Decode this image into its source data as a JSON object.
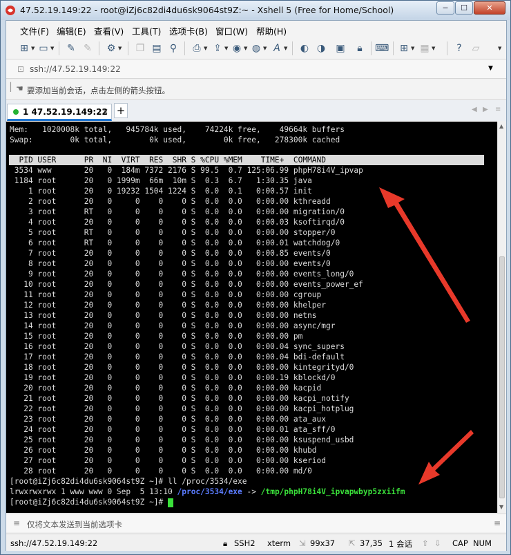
{
  "window": {
    "title": "47.52.19.149:22 - root@iZj6c82di4du6sk9064st9Z:~ - Xshell 5 (Free for Home/School)",
    "min": "−",
    "max": "☐",
    "close": "✕"
  },
  "menu": [
    "文件(F)",
    "编辑(E)",
    "查看(V)",
    "工具(T)",
    "选项卡(B)",
    "窗口(W)",
    "帮助(H)"
  ],
  "address": {
    "value": "ssh://47.52.19.149:22"
  },
  "info": {
    "text": "要添加当前会话，点击左侧的箭头按钮。"
  },
  "tab": {
    "label": "1 47.52.19.149:22",
    "close": "×",
    "add": "+"
  },
  "terminal": {
    "lines": [
      "Mem:   1020008k total,   945784k used,    74224k free,    49664k buffers",
      "Swap:        0k total,        0k used,        0k free,   278300k cached",
      "",
      "  PID USER      PR  NI  VIRT  RES  SHR S %CPU %MEM    TIME+  COMMAND",
      " 3534 www       20   0  184m 7372 2176 S 99.5  0.7 125:06.99 phpH78i4V_ipvap",
      " 1184 root      20   0 1999m  66m  10m S  0.3  6.7   1:30.35 java",
      "    1 root      20   0 19232 1504 1224 S  0.0  0.1   0:00.57 init",
      "    2 root      20   0     0    0    0 S  0.0  0.0   0:00.00 kthreadd",
      "    3 root      RT   0     0    0    0 S  0.0  0.0   0:00.00 migration/0",
      "    4 root      20   0     0    0    0 S  0.0  0.0   0:00.03 ksoftirqd/0",
      "    5 root      RT   0     0    0    0 S  0.0  0.0   0:00.00 stopper/0",
      "    6 root      RT   0     0    0    0 S  0.0  0.0   0:00.01 watchdog/0",
      "    7 root      20   0     0    0    0 S  0.0  0.0   0:00.85 events/0",
      "    8 root      20   0     0    0    0 S  0.0  0.0   0:00.00 events/0",
      "    9 root      20   0     0    0    0 S  0.0  0.0   0:00.00 events_long/0",
      "   10 root      20   0     0    0    0 S  0.0  0.0   0:00.00 events_power_ef",
      "   11 root      20   0     0    0    0 S  0.0  0.0   0:00.00 cgroup",
      "   12 root      20   0     0    0    0 S  0.0  0.0   0:00.00 khelper",
      "   13 root      20   0     0    0    0 S  0.0  0.0   0:00.00 netns",
      "   14 root      20   0     0    0    0 S  0.0  0.0   0:00.00 async/mgr",
      "   15 root      20   0     0    0    0 S  0.0  0.0   0:00.00 pm",
      "   16 root      20   0     0    0    0 S  0.0  0.0   0:00.04 sync_supers",
      "   17 root      20   0     0    0    0 S  0.0  0.0   0:00.04 bdi-default",
      "   18 root      20   0     0    0    0 S  0.0  0.0   0:00.00 kintegrityd/0",
      "   19 root      20   0     0    0    0 S  0.0  0.0   0:00.19 kblockd/0",
      "   20 root      20   0     0    0    0 S  0.0  0.0   0:00.00 kacpid",
      "   21 root      20   0     0    0    0 S  0.0  0.0   0:00.00 kacpi_notify",
      "   22 root      20   0     0    0    0 S  0.0  0.0   0:00.00 kacpi_hotplug",
      "   23 root      20   0     0    0    0 S  0.0  0.0   0:00.00 ata_aux",
      "   24 root      20   0     0    0    0 S  0.0  0.0   0:00.01 ata_sff/0",
      "   25 root      20   0     0    0    0 S  0.0  0.0   0:00.00 ksuspend_usbd",
      "   26 root      20   0     0    0    0 S  0.0  0.0   0:00.00 khubd",
      "   27 root      20   0     0    0    0 S  0.0  0.0   0:00.00 kseriod",
      "   28 root      20   0     0    0    0 S  0.0  0.0   0:00.00 md/0",
      "[root@iZj6c82di4du6sk9064st9Z ~]# ll /proc/3534/exe"
    ],
    "ll_prefix": "lrwxrwxrwx 1 www www 0 Sep  5 13:10 ",
    "ll_link": "/proc/3534/exe",
    "ll_arrow": " -> ",
    "ll_target": "/tmp/phpH78i4V_ipvapwbyp5zxiifm",
    "prompt": "[root@iZj6c82di4du6sk9064st9Z ~]# ",
    "colors": {
      "bg": "#000000",
      "fg": "#dcdcdc",
      "link": "#5b7cff",
      "target": "#3ae03a",
      "arrow": "#e8392a"
    }
  },
  "send": {
    "placeholder": "仅将文本发送到当前选项卡"
  },
  "status": {
    "session": "ssh://47.52.19.149:22",
    "protocol": "SSH2",
    "term": "xterm",
    "size": "99x37",
    "cursor": "37,35",
    "sessions": "1 会话",
    "caps": "CAP",
    "num": "NUM"
  }
}
